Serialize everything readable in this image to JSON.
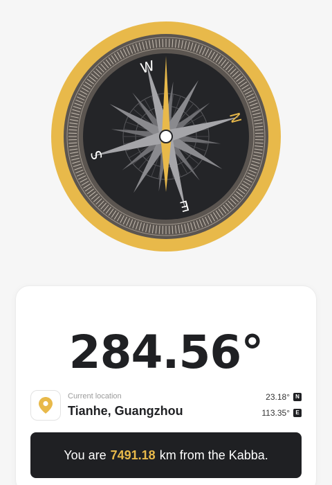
{
  "compass": {
    "heading_deg": 284.56,
    "cardinals": {
      "n": "N",
      "e": "E",
      "s": "S",
      "w": "W"
    },
    "colors": {
      "ring": "#e8b94a",
      "bezel": "#5b5550",
      "face": "#242528",
      "needle": "#e8b94a"
    }
  },
  "heading": {
    "display": "284.56°"
  },
  "location": {
    "caption": "Current location",
    "name": "Tianhe, Guangzhou",
    "lat_value": "23.18°",
    "lat_dir": "N",
    "lon_value": "113.35°",
    "lon_dir": "E"
  },
  "distance": {
    "prefix": "You are",
    "value": "7491.18",
    "suffix": "km from the Kabba."
  },
  "icons": {
    "location": "location-pin-icon"
  }
}
